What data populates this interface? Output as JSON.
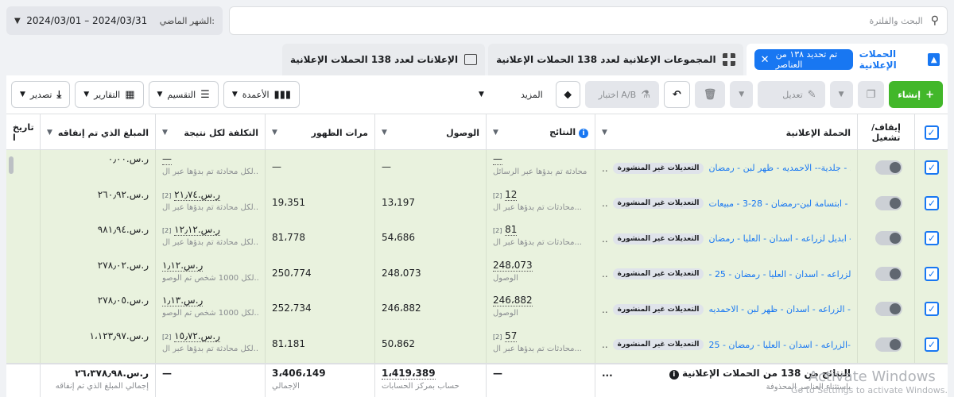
{
  "topbar": {
    "date_label": "الشهر الماضي:",
    "date_range": "2024/03/01 – 2024/03/31",
    "search_placeholder": "البحث والفلترة"
  },
  "tabs": {
    "ads": "الإعلانات لعدد 138 الحملات الإعلانية",
    "adsets": "المجموعات الإعلانية لعدد 138 الحملات الإعلانية",
    "campaigns": "الحملات الإعلانية",
    "chip": "تم تحديد ١٣٨ من العناصر"
  },
  "toolbar": {
    "create": "إنشاء",
    "edit": "تعديل",
    "ab_test": "اختبار A/B",
    "more": "المزيد",
    "columns": "الأعمدة",
    "breakdown": "التقسيم",
    "reports": "التقارير",
    "export": "تصدير"
  },
  "columns": {
    "toggle": "إيقاف/ تشغيل",
    "campaign": "الحملة الإعلانية",
    "results": "النتائج",
    "reach": "الوصول",
    "impressions": "مرات الظهور",
    "cost_per_result": "التكلفة لكل نتيجة",
    "amount_spent": "المبلغ الذي تم إنفاقه",
    "end_date": "تاريخ ا"
  },
  "rows": [
    {
      "name": "جلدية-- الاحمديه - ظهر لبن - رمضان - ...",
      "tag": "التعديلات غير المنشورة",
      "results": "—",
      "results_sub": "محادثة تم بدؤها عبر الرسائل",
      "results_sup": "",
      "reach": "—",
      "impressions": "—",
      "cost": "—",
      "cost_sub": "لكل محادثة تم بدؤها عبر ال...",
      "cost_sup": "",
      "spent": "ر.س.٠٫٠٠"
    },
    {
      "name": "ابتسامة لبن-رمضان - 28-3 - مبيعات - - ...",
      "tag": "التعديلات غير المنشورة",
      "results": "12",
      "results_sub": "محادثات تم بدؤها عبر ال...",
      "results_sup": "[2]",
      "reach": "13،197",
      "impressions": "19،351",
      "cost": "ر.س.٢١٫٧٤",
      "cost_sub": "لكل محادثة تم بدؤها عبر ال...",
      "cost_sup": "[2]",
      "spent": "ر.س.٢٦٠٫٩٢"
    },
    {
      "name": "ابديل لزراعه - اسدان - العليا - رمضان - ...",
      "tag": "التعديلات غير المنشورة",
      "results": "81",
      "results_sub": "محادثات تم بدؤها عبر ال...",
      "results_sup": "[2]",
      "reach": "54،686",
      "impressions": "81،778",
      "cost": "ر.س.١٢٫١٢",
      "cost_sub": "لكل محادثة تم بدؤها عبر ال...",
      "cost_sup": "[2]",
      "spent": "ر.س.٩٨١٫٩٤"
    },
    {
      "name": "- الزراعه - اسدان - العليا - رمضان - 25...",
      "tag": "التعديلات غير المنشورة",
      "results": "248،073",
      "results_sub": "الوصول",
      "results_sup": "",
      "reach": "248،073",
      "impressions": "250،774",
      "cost": "ر.س.١٫١٢",
      "cost_sub": "لكل 1000 شخص تم الوصو...",
      "cost_sup": "",
      "spent": "ر.س.٢٧٨٫٠٢"
    },
    {
      "name": "الزراعه - اسدان - ظهر لبن - الاحمديه - ...",
      "tag": "التعديلات غير المنشورة",
      "results": "246،882",
      "results_sub": "الوصول",
      "results_sup": "",
      "reach": "246،882",
      "impressions": "252،734",
      "cost": "ر.س.١٫١٣",
      "cost_sub": "لكل 1000 شخص تم الوصو...",
      "cost_sup": "",
      "spent": "ر.س.٢٧٨٫٠٥"
    },
    {
      "name": "الزراعه - اسدان - العليا - رمضان - 25-...",
      "tag": "التعديلات غير المنشورة",
      "results": "57",
      "results_sub": "محادثات تم بدؤها عبر ال...",
      "results_sup": "[2]",
      "reach": "50،862",
      "impressions": "81،181",
      "cost": "ر.س.١٥٫٧٢",
      "cost_sub": "لكل محادثة تم بدؤها عبر ال...",
      "cost_sup": "[2]",
      "spent": "ر.س.١،١٢٣٫٩٧"
    }
  ],
  "totals": {
    "label": "النتائج من 138 من الحملات الإعلانية",
    "sub": "باستثناء العناصر المحذوفة",
    "results": "—",
    "reach": "1،419،389",
    "reach_sub": "حساب بمركز الحسابات",
    "impressions": "3،406،149",
    "impressions_sub": "الإجمالي",
    "cost": "—",
    "spent": "ر.س.٢٦،٣٧٨٫٩٨",
    "spent_sub": "إجمالي المبلغ الذي تم إنفاقه",
    "dots": "..."
  },
  "watermark": {
    "line1": "Activate Windows",
    "line2": "Go to Settings to activate Windows."
  }
}
